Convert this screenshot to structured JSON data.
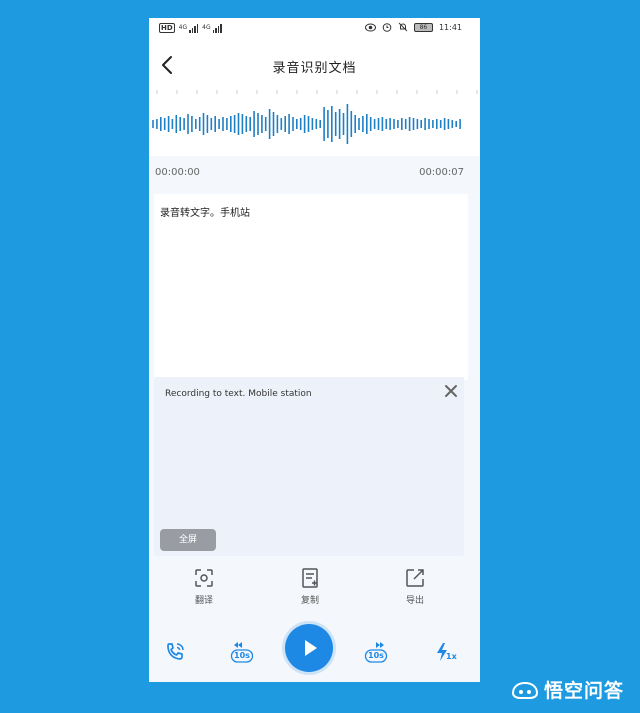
{
  "status_bar": {
    "hd": "HD",
    "net1": "4G",
    "net2": "4G",
    "battery": "86",
    "time": "11:41",
    "icons": [
      "eye-icon",
      "alarm-icon",
      "mute-bell-icon",
      "battery-icon"
    ]
  },
  "header": {
    "title": "录音识别文档",
    "back_icon": "chevron-left-icon"
  },
  "player_timeline": {
    "start": "00:00:00",
    "end": "00:00:07"
  },
  "transcript": {
    "text": "录音转文字。手机站"
  },
  "translation": {
    "text": "Recording to text. Mobile station",
    "fullscreen_label": "全屏",
    "close_icon": "close-icon"
  },
  "actions": [
    {
      "label": "翻译",
      "icon": "translate-scan-icon"
    },
    {
      "label": "复制",
      "icon": "copy-doc-icon"
    },
    {
      "label": "导出",
      "icon": "export-icon"
    }
  ],
  "player_controls": {
    "phone_icon": "phone-call-icon",
    "rewind_label": "10s",
    "forward_label": "10s",
    "speed_label": "1x",
    "play_icon": "play-icon"
  },
  "watermark": {
    "text": "悟空问答"
  },
  "colors": {
    "background": "#1e9be0",
    "accent": "#1e88e5",
    "wave": "#1f7fc4"
  }
}
